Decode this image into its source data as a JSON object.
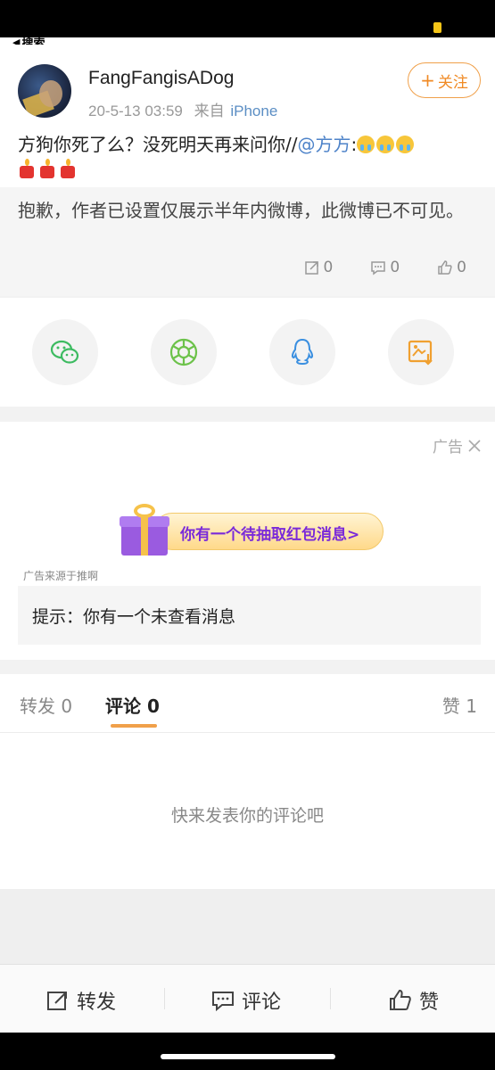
{
  "status_bar": {
    "back_label": "搜索"
  },
  "post": {
    "username": "FangFangisADog",
    "timestamp": "20-5-13 03:59",
    "source_prefix": "来自",
    "source": "iPhone",
    "follow_label": "关注",
    "text_main": "方狗你死了么？没死明天再来问你//",
    "mention": "@方方",
    "mention_suffix": ":"
  },
  "quoted": {
    "text": "抱歉，作者已设置仅展示半年内微博，此微博已不可见。",
    "reposts": "0",
    "comments": "0",
    "likes": "0"
  },
  "share": {
    "icons": [
      "wechat-icon",
      "moments-icon",
      "qq-icon",
      "save-image-icon"
    ]
  },
  "ad": {
    "label": "广告",
    "banner_text": "你有一个待抽取红包消息>",
    "source": "广告来源于推啊",
    "tip": "提示：你有一个未查看消息"
  },
  "tabs": {
    "repost": "转发 0",
    "comment": "评论 0",
    "like": "赞 1"
  },
  "comments": {
    "empty": "快来发表你的评论吧"
  },
  "actions": {
    "repost": "转发",
    "comment": "评论",
    "like": "赞"
  },
  "colors": {
    "accent": "#f0a04a",
    "link": "#4e83c9",
    "banner_text": "#7a2ad9"
  }
}
